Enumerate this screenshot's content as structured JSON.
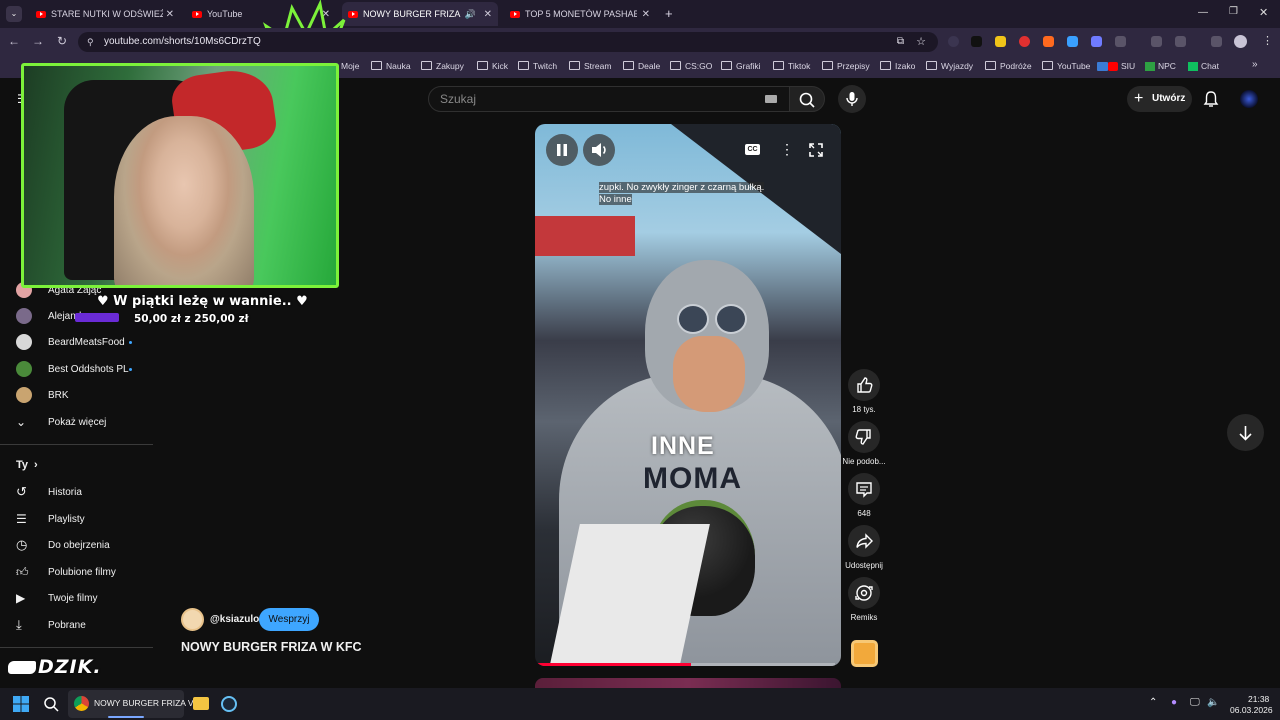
{
  "browser": {
    "tabs": [
      {
        "title": "STARE NUTKI W ODŚWIEŻENIU"
      },
      {
        "title": "YouTube"
      },
      {
        "title": "NOWY BURGER FRIZA W KFC"
      },
      {
        "title": "TOP 5 MONETÓW PASHABICEP"
      }
    ],
    "url": "youtube.com/shorts/10Ms6CDrzTQ",
    "bookmarks": [
      "Moje",
      "Nauka",
      "Zakupy",
      "Kick",
      "Twitch",
      "Stream",
      "Deale",
      "CS:GO",
      "Grafiki",
      "Tiktok",
      "Przepisy",
      "Izako",
      "Wyjazdy",
      "Podróże",
      "YouTube",
      "SIU",
      "NPC",
      "Chat"
    ]
  },
  "youtube": {
    "search_placeholder": "Szukaj",
    "create_label": "Utwórz",
    "sidebar": {
      "subscriptions": [
        {
          "name": "Agata Zając"
        },
        {
          "name": "Alejand..."
        },
        {
          "name": "BeardMeatsFood"
        },
        {
          "name": "Best Oddshots PL"
        },
        {
          "name": "BRK"
        }
      ],
      "show_more": "Pokaż więcej",
      "you_header": "Ty",
      "you_items": [
        {
          "label": "Historia",
          "icon": "history-icon"
        },
        {
          "label": "Playlisty",
          "icon": "playlist-icon"
        },
        {
          "label": "Do obejrzenia",
          "icon": "watch-later-icon"
        },
        {
          "label": "Polubione filmy",
          "icon": "thumb-up-icon"
        },
        {
          "label": "Twoje filmy",
          "icon": "video-icon"
        },
        {
          "label": "Pobrane",
          "icon": "download-icon"
        }
      ]
    },
    "short": {
      "channel": "@ksiazulo",
      "support_label": "Wesprzyj",
      "title": "NOWY BURGER FRIZA W KFC",
      "caption_lines": [
        "zupki. No zwykły zinger z czarną bułką.",
        "No inne"
      ],
      "overlay_text_1": "INNE",
      "overlay_text_2": "MOMA",
      "progress": 0.52
    },
    "actions": [
      {
        "label": "18 tys.",
        "icon": "thumb-up-icon"
      },
      {
        "label": "Nie podob...",
        "icon": "thumb-down-icon"
      },
      {
        "label": "648",
        "icon": "comment-icon"
      },
      {
        "label": "Udostępnij",
        "icon": "share-icon"
      },
      {
        "label": "Remiks",
        "icon": "remix-icon"
      }
    ]
  },
  "stream_overlay": {
    "donation_text": "♥ W piątki leżę w wannie.. ♥",
    "goal_text": "50,00 zł  z  250,00 zł",
    "logo_text": "DZIK."
  },
  "taskbar": {
    "active_app": "NOWY BURGER FRIZA V",
    "time": "21:38",
    "date": "06.03.2026"
  },
  "colors": {
    "accent_green": "#7cf23a",
    "youtube_red": "#ff0000",
    "support_blue": "#3ea6ff"
  }
}
